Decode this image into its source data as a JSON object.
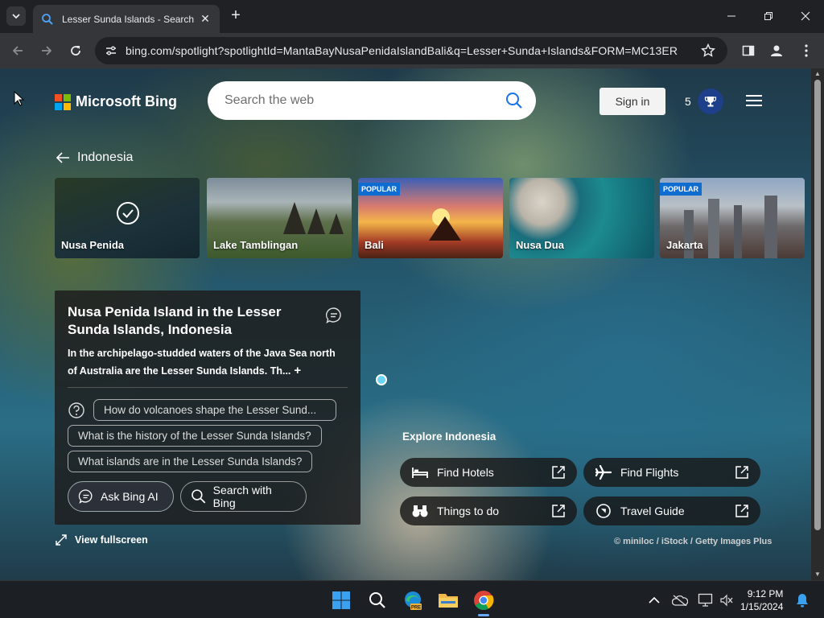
{
  "browser": {
    "tab_title": "Lesser Sunda Islands - Search",
    "url": "bing.com/spotlight?spotlightId=MantaBayNusaPenidaIslandBali&q=Lesser+Sunda+Islands&FORM=MC13ER"
  },
  "header": {
    "logo_text": "Microsoft Bing",
    "search_placeholder": "Search the web",
    "signin_label": "Sign in",
    "points": "5"
  },
  "breadcrumb": {
    "label": "Indonesia"
  },
  "carousel": [
    {
      "label": "Nusa Penida",
      "badge": "",
      "selected": true
    },
    {
      "label": "Lake Tamblingan",
      "badge": ""
    },
    {
      "label": "Bali",
      "badge": "POPULAR"
    },
    {
      "label": "Nusa Dua",
      "badge": ""
    },
    {
      "label": "Jakarta",
      "badge": "POPULAR"
    }
  ],
  "panel": {
    "title": "Nusa Penida Island in the Lesser Sunda Islands, Indonesia",
    "description": "In the archipelago-studded waters of the Java Sea north of Australia are the Lesser Sunda Islands. Th...",
    "more": "+",
    "questions": [
      "How do volcanoes shape the Lesser Sund...",
      "What is the history of the Lesser Sunda Islands?",
      "What islands are in the Lesser Sunda Islands?"
    ],
    "ask_label": "Ask Bing AI",
    "search_label": "Search with Bing"
  },
  "view_fullscreen": "View fullscreen",
  "explore": {
    "title": "Explore Indonesia",
    "buttons": [
      {
        "label": "Find Hotels",
        "icon": "bed-icon"
      },
      {
        "label": "Find Flights",
        "icon": "plane-icon"
      },
      {
        "label": "Things to do",
        "icon": "binoculars-icon"
      },
      {
        "label": "Travel Guide",
        "icon": "compass-icon"
      }
    ]
  },
  "credit": "© miniloc / iStock / Getty Images Plus",
  "taskbar": {
    "time": "9:12 PM",
    "date": "1/15/2024"
  }
}
